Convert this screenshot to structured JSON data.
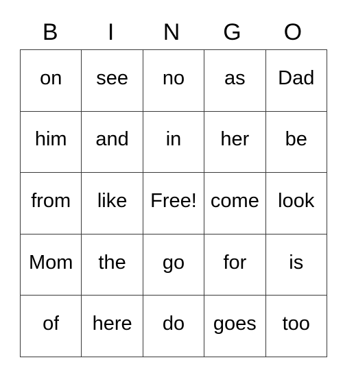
{
  "card": {
    "title": "BINGO",
    "headers": [
      "B",
      "I",
      "N",
      "G",
      "O"
    ],
    "free_space_label": "Free!",
    "free_space_position": {
      "row": 2,
      "col": 2
    },
    "text_color": "#000000",
    "border_color": "#3a3a3a",
    "background_color": "#ffffff",
    "rows": [
      {
        "cells": [
          "on",
          "see",
          "no",
          "as",
          "Dad"
        ]
      },
      {
        "cells": [
          "him",
          "and",
          "in",
          "her",
          "be"
        ]
      },
      {
        "cells": [
          "from",
          "like",
          "Free!",
          "come",
          "look"
        ]
      },
      {
        "cells": [
          "Mom",
          "the",
          "go",
          "for",
          "is"
        ]
      },
      {
        "cells": [
          "of",
          "here",
          "do",
          "goes",
          "too"
        ]
      }
    ]
  }
}
